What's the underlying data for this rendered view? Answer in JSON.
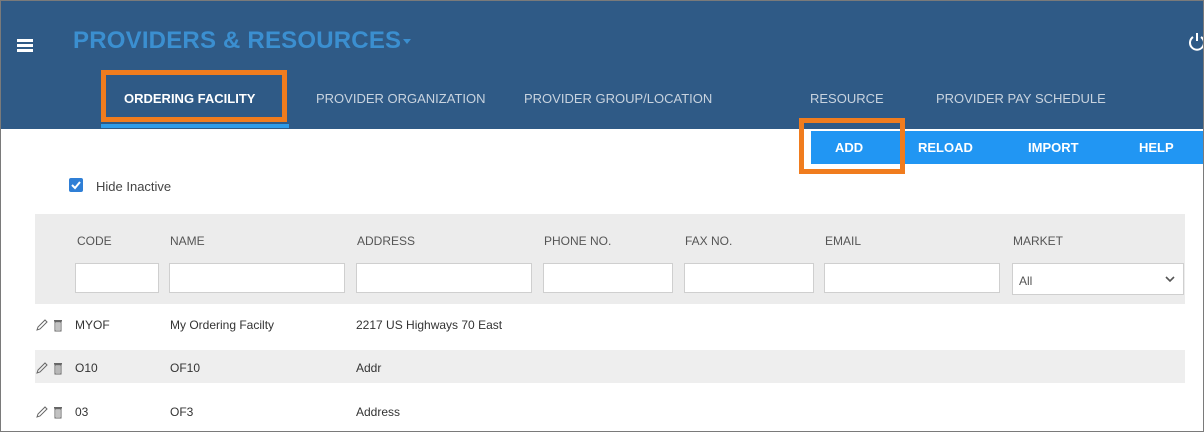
{
  "header": {
    "app_title": "PROVIDERS & RESOURCES",
    "tabs": [
      {
        "label": "ORDERING FACILITY",
        "active": true
      },
      {
        "label": "PROVIDER ORGANIZATION",
        "active": false
      },
      {
        "label": "PROVIDER GROUP/LOCATION",
        "active": false
      },
      {
        "label": "RESOURCE",
        "active": false
      },
      {
        "label": "PROVIDER PAY SCHEDULE",
        "active": false
      }
    ]
  },
  "toolbar": {
    "add_label": "ADD",
    "reload_label": "RELOAD",
    "import_label": "IMPORT",
    "help_label": "HELP"
  },
  "filters": {
    "hide_inactive_label": "Hide Inactive",
    "hide_inactive_checked": true
  },
  "table": {
    "columns": [
      "CODE",
      "NAME",
      "ADDRESS",
      "PHONE NO.",
      "FAX NO.",
      "EMAIL",
      "MARKET"
    ],
    "market_filter_value": "All",
    "rows": [
      {
        "code": "MYOF",
        "name": "My Ordering Facilty",
        "address": "2217 US Highways 70 East"
      },
      {
        "code": "O10",
        "name": "OF10",
        "address": "Addr"
      },
      {
        "code": "03",
        "name": "OF3",
        "address": "Address"
      }
    ]
  },
  "icons": {
    "menu": "hamburger-menu-icon",
    "power": "power-icon",
    "edit": "pencil-icon",
    "delete": "trash-icon",
    "dropdown": "chevron-down-icon"
  },
  "colors": {
    "header_bg": "#2f5a86",
    "title_blue": "#3b8fd0",
    "toolbar_blue": "#2196f3",
    "highlight_orange": "#f07c1e",
    "row_alt": "#eeeeee"
  }
}
